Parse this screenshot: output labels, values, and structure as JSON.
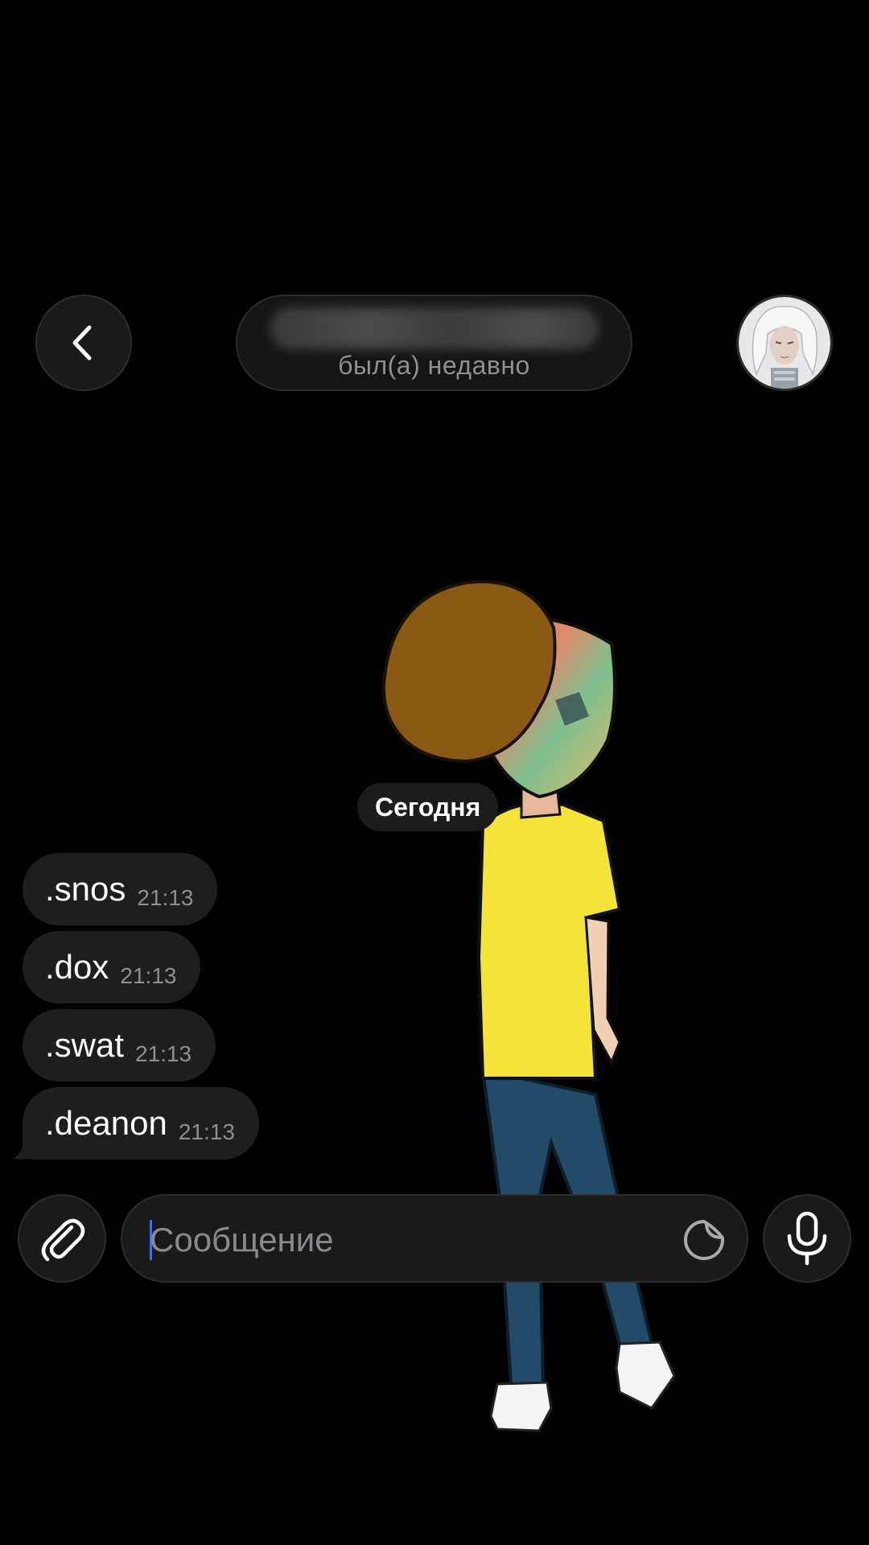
{
  "header": {
    "status": "был(а) недавно"
  },
  "chat": {
    "date_badge": "Сегодня",
    "messages": [
      {
        "text": ".snos",
        "time": "21:13"
      },
      {
        "text": ".dox",
        "time": "21:13"
      },
      {
        "text": ".swat",
        "time": "21:13"
      },
      {
        "text": ".deanon",
        "time": "21:13"
      }
    ]
  },
  "composer": {
    "placeholder": "Сообщение"
  },
  "icons": {
    "back": "chevron-left-icon",
    "attach": "paperclip-icon",
    "sticker": "sticker-icon",
    "mic": "microphone-icon"
  },
  "colors": {
    "background": "#000000",
    "bubble": "#1e1e1e",
    "secondary_text": "#8e8e93",
    "caret": "#3d6fe0"
  }
}
